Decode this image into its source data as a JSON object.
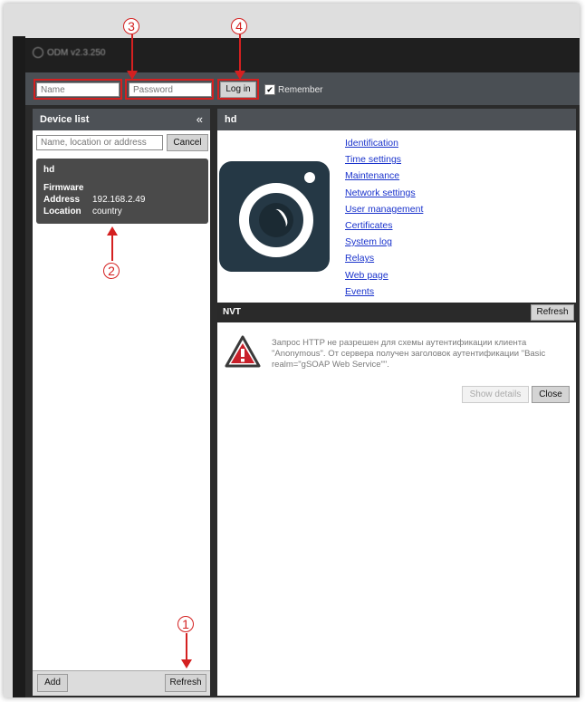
{
  "app": {
    "title": "ODM v2.3.250"
  },
  "login": {
    "name_placeholder": "Name",
    "password_placeholder": "Password",
    "login_button": "Log in",
    "remember_label": "Remember",
    "remember_checked": true
  },
  "device_list": {
    "header": "Device list",
    "collapse_symbol": "«",
    "search_placeholder": "Name, location or address",
    "cancel_button": "Cancel",
    "device": {
      "name": "hd",
      "firmware_label": "Firmware",
      "address_label": "Address",
      "address_value": "192.168.2.49",
      "location_label": "Location",
      "location_value": "country"
    },
    "add_button": "Add",
    "refresh_button": "Refresh"
  },
  "device_panel": {
    "header": "hd",
    "links": [
      "Identification",
      "Time settings",
      "Maintenance",
      "Network settings",
      "User management",
      "Certificates",
      "System log",
      "Relays",
      "Web page",
      "Events"
    ]
  },
  "nvt": {
    "header": "NVT",
    "refresh_button": "Refresh",
    "message": "Запрос HTTP не разрешен для схемы аутентификации клиента \"Anonymous\". От сервера получен заголовок аутентификации \"Basic realm=\"gSOAP Web Service\"\".",
    "show_details_button": "Show details",
    "close_button": "Close"
  },
  "annotations": {
    "a1": "1",
    "a2": "2",
    "a3": "3",
    "a4": "4"
  },
  "colors": {
    "annotation": "#d42020",
    "link": "#1a33cc",
    "panel_header": "#4d5156"
  }
}
